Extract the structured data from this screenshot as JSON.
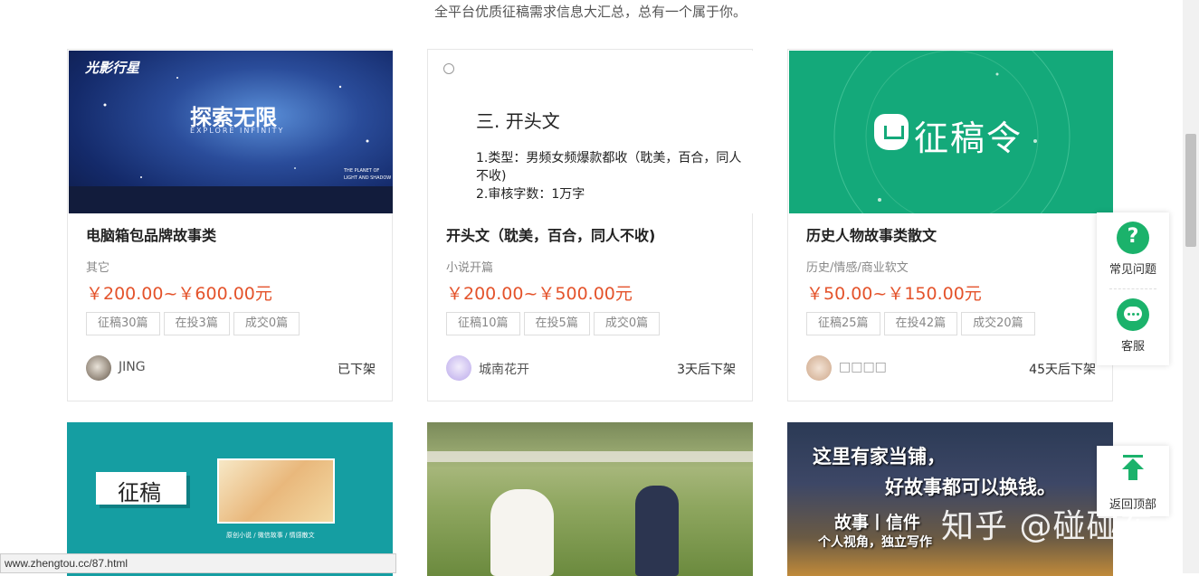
{
  "subtitle": "全平台优质征稿需求信息大汇总，总有一个属于你。",
  "cards": [
    {
      "title": "电脑箱包品牌故事类",
      "category": "其它",
      "price": "￥200.00~￥600.00元",
      "tags": [
        "征稿30篇",
        "在投3篇",
        "成交0篇"
      ],
      "user": "JING",
      "status": "已下架",
      "image": {
        "brand": "光影行星",
        "headline": "探索无限",
        "sub": "EXPLORE INFINITY",
        "tagline1": "THE PLANET OF",
        "tagline2": "LIGHT AND SHADOW"
      }
    },
    {
      "title": "开头文（耽美，百合，同人不收)",
      "category": "小说开篇",
      "price": "￥200.00~￥500.00元",
      "tags": [
        "征稿10篇",
        "在投5篇",
        "成交0篇"
      ],
      "user": "城南花开",
      "status": "3天后下架",
      "image": {
        "heading": "三. 开头文",
        "line1": "1.类型：男频女频爆款都收（耽美，百合，同人不收)",
        "line2": "2.审核字数：1万字"
      }
    },
    {
      "title": "历史人物故事类散文",
      "category": "历史/情感/商业软文",
      "price": "￥50.00~￥150.00元",
      "tags": [
        "征稿25篇",
        "在投42篇",
        "成交20篇"
      ],
      "user": "□□□□",
      "status": "45天后下架",
      "image": {
        "logo_text": "征稿令"
      }
    }
  ],
  "row2": [
    {
      "image": {
        "badge": "征稿",
        "caption": "原创小说 / 微信故事 / 情感散文"
      }
    },
    {
      "image": {}
    },
    {
      "image": {
        "line1": "这里有家当铺，",
        "line2": "好故事都可以换钱。",
        "line3": "故事丨信件",
        "line4": "个人视角，独立写作"
      }
    }
  ],
  "float_panel": {
    "faq_label": "常见问题",
    "service_label": "客服",
    "back_top_label": "返回顶部"
  },
  "status_url": "www.zhengtou.cc/87.html",
  "watermark": "知乎 @碰碰车",
  "colors": {
    "price": "#e4532b",
    "accent_green": "#1bb26b",
    "card3_bg": "#14a97a",
    "card4_bg": "#159ea2"
  }
}
